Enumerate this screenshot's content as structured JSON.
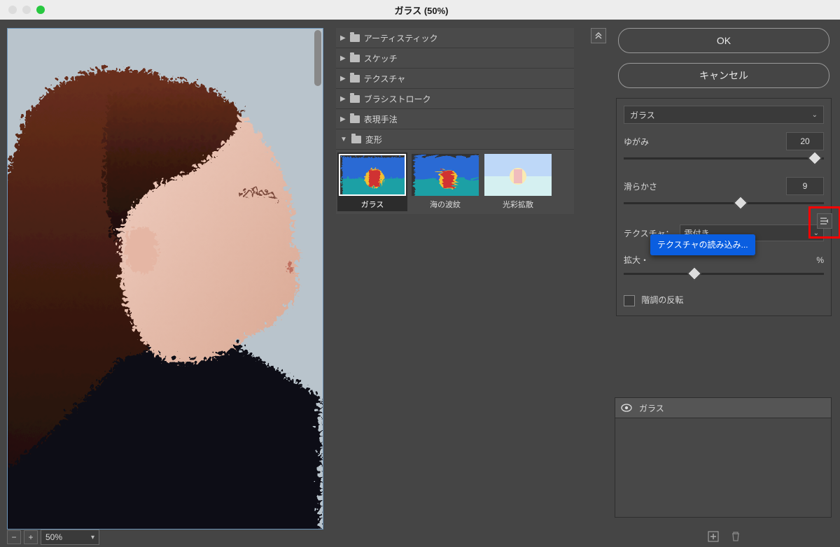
{
  "window": {
    "title": "ガラス (50%)"
  },
  "preview": {
    "zoom_level": "50%"
  },
  "filter_tree": {
    "categories": [
      "アーティスティック",
      "スケッチ",
      "テクスチャ",
      "ブラシストローク",
      "表現手法",
      "変形"
    ],
    "open_category_index": 5,
    "thumbnails": [
      {
        "label": "ガラス",
        "selected": true
      },
      {
        "label": "海の波紋",
        "selected": false
      },
      {
        "label": "光彩拡散",
        "selected": false
      }
    ]
  },
  "controls": {
    "ok_label": "OK",
    "cancel_label": "キャンセル",
    "filter_select": "ガラス",
    "distortion_label": "ゆがみ",
    "distortion_value": "20",
    "smoothness_label": "滑らかさ",
    "smoothness_value": "9",
    "texture_label": "テクスチャ：",
    "texture_value": "霜付き",
    "scale_label": "拡大・",
    "scale_unit": "%",
    "invert_label": "階調の反転",
    "texture_menu_item": "テクスチャの読み込み..."
  },
  "layers": {
    "entry": "ガラス"
  }
}
